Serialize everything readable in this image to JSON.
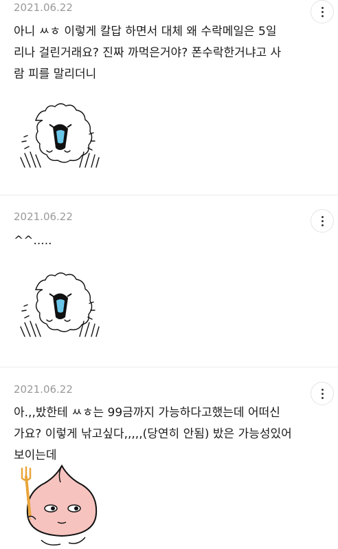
{
  "comments": [
    {
      "date": "2021.06.22",
      "text": "아니 ㅆㅎ 이렇게 칼답 하면서 대체 왜 수락메일은 5일\n리나 걸린거래요? 진짜 까먹은거야? 폰수락한거냐고 사\n람 피를 말리더니",
      "sticker_name": "crying-fluffy-dog-sticker"
    },
    {
      "date": "2021.06.22",
      "text": "^^.....",
      "sticker_name": "crying-fluffy-dog-sticker"
    },
    {
      "date": "2021.06.22",
      "text": "아.,,밨한테 ㅆㅎ는 99금까지 가능하다고했는데 어떠신\n가요? 이렇게 낚고싶다,,,,,(당연히 안됨) 밨은 가능성있어\n보이는데",
      "sticker_name": "peach-with-fork-sticker"
    }
  ],
  "icons": {
    "more": "more-vertical-icon"
  }
}
